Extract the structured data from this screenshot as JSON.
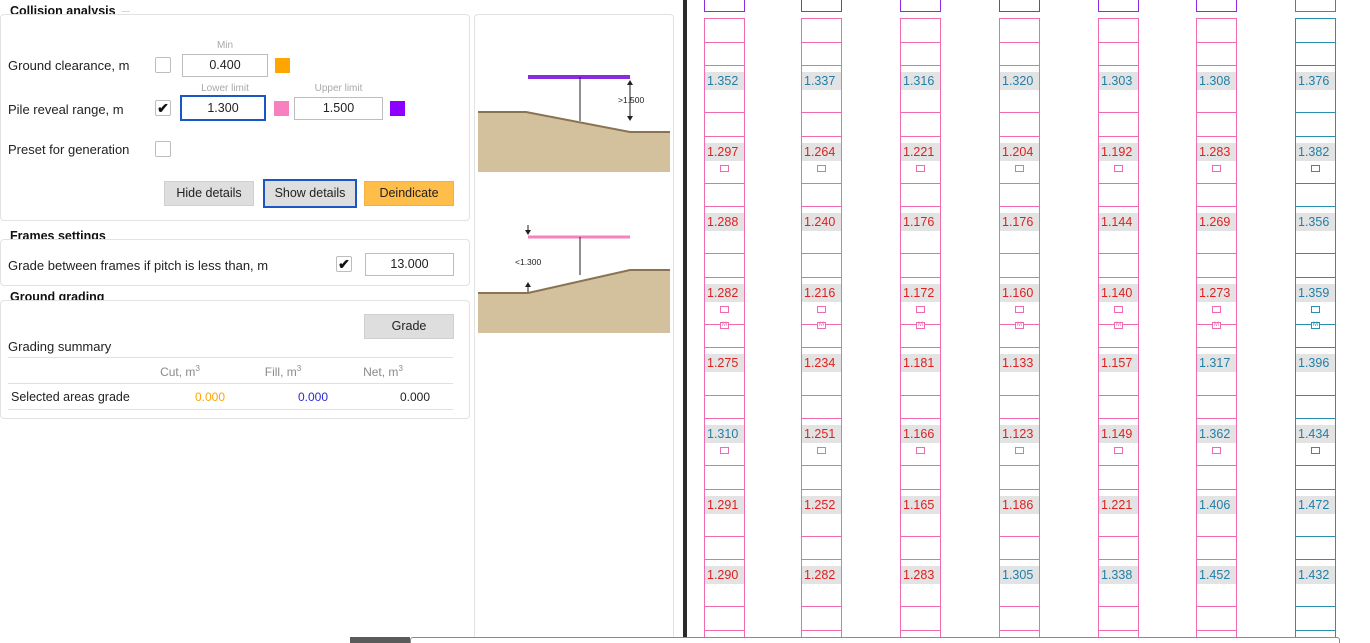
{
  "collision": {
    "title": "Collision analysis",
    "min_label": "Min",
    "ground_clearance_label": "Ground clearance, m",
    "ground_clearance_value": "0.400",
    "lower_limit_label": "Lower limit",
    "upper_limit_label": "Upper limit",
    "pile_reveal_label": "Pile reveal range, m",
    "pile_lower_value": "1.300",
    "pile_upper_value": "1.500",
    "preset_label": "Preset for generation",
    "hide_details": "Hide details",
    "show_details": "Show details",
    "deindicate": "Deindicate",
    "ground_clearance_checked": false,
    "pile_reveal_checked": true,
    "preset_checked": false,
    "colors": {
      "clearance": "#ffa500",
      "lower": "#f780bf",
      "upper": "#8b00ff"
    }
  },
  "frames": {
    "title": "Frames settings",
    "grade_label": "Grade between frames if pitch is less than, m",
    "grade_checked": true,
    "grade_value": "13.000"
  },
  "grading": {
    "title": "Ground grading",
    "grade_button": "Grade",
    "summary_label": "Grading summary",
    "columns": [
      "Cut, m",
      "Fill, m",
      "Net, m"
    ],
    "unit_exp": "3",
    "row_label": "Selected areas grade",
    "cut": "0.000",
    "fill": "0.000",
    "net": "0.000"
  },
  "diagrams": {
    "upper_label": ">1.500",
    "lower_label": "<1.300"
  },
  "grid": {
    "columns": [
      {
        "values": [
          "1.352",
          "1.297",
          "1.288",
          "1.282",
          "1.275",
          "1.310",
          "1.291",
          "1.290"
        ],
        "cell_color": "#f06ab2"
      },
      {
        "values": [
          "1.337",
          "1.264",
          "1.240",
          "1.216",
          "1.234",
          "1.251",
          "1.252",
          "1.282"
        ],
        "cell_color": "#f06ab2"
      },
      {
        "values": [
          "1.316",
          "1.221",
          "1.176",
          "1.172",
          "1.181",
          "1.166",
          "1.165",
          "1.283"
        ],
        "cell_color": "#f06ab2"
      },
      {
        "values": [
          "1.320",
          "1.204",
          "1.176",
          "1.160",
          "1.133",
          "1.123",
          "1.186",
          "1.305"
        ],
        "cell_color": "#f06ab2"
      },
      {
        "values": [
          "1.303",
          "1.192",
          "1.144",
          "1.140",
          "1.157",
          "1.149",
          "1.221",
          "1.338"
        ],
        "cell_color": "#f06ab2"
      },
      {
        "values": [
          "1.308",
          "1.283",
          "1.269",
          "1.273",
          "1.317",
          "1.362",
          "1.406",
          "1.452"
        ],
        "cell_color": "#f06ab2"
      },
      {
        "values": [
          "1.376",
          "1.382",
          "1.356",
          "1.359",
          "1.396",
          "1.434",
          "1.472",
          "1.432"
        ],
        "cell_color": "#2a8fb0"
      }
    ],
    "colors": {
      "red": "#e02020",
      "blue": "#1f7fa8",
      "pink": "#f06ab2",
      "teal": "#2a8fb0",
      "purple": "#8b2be2"
    }
  }
}
